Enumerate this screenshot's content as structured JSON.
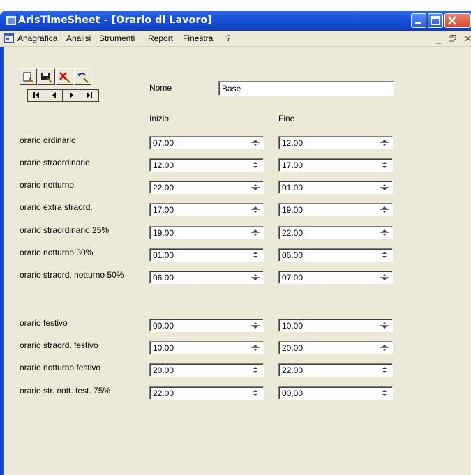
{
  "window": {
    "title": "ArisTimeSheet - [Orario di Lavoro]",
    "menu": [
      "Anagrafica",
      "Analisi",
      "Strumenti",
      "Report",
      "Finestra",
      "?"
    ]
  },
  "toolbar": {
    "buttons": [
      "new-record-icon",
      "save-record-icon",
      "delete-record-icon",
      "undo-icon"
    ],
    "nav": [
      "first",
      "prev",
      "next",
      "last"
    ]
  },
  "form": {
    "nome_label": "Nome",
    "nome_value": "Base",
    "inizio_label": "Inizio",
    "fine_label": "Fine",
    "rows": [
      {
        "label": "orario ordinario",
        "inizio": "07.00",
        "fine": "12.00"
      },
      {
        "label": "orario straordinario",
        "inizio": "12.00",
        "fine": "17.00"
      },
      {
        "label": "orario notturno",
        "inizio": "22.00",
        "fine": "01.00"
      },
      {
        "label": "orario extra straord.",
        "inizio": "17.00",
        "fine": "19.00"
      },
      {
        "label": "orario straordinario 25%",
        "inizio": "19.00",
        "fine": "22.00"
      },
      {
        "label": "orario notturno 30%",
        "inizio": "01.00",
        "fine": "06.00"
      },
      {
        "label": "orario straord. notturno 50%",
        "inizio": "06.00",
        "fine": "07.00"
      },
      {
        "label": "orario festivo",
        "inizio": "00.00",
        "fine": "10.00"
      },
      {
        "label": "orario straord. festivo",
        "inizio": "10.00",
        "fine": "20.00"
      },
      {
        "label": "orario notturno festivo",
        "inizio": "20.00",
        "fine": "22.00"
      },
      {
        "label": "orario str. nott. fest. 75%",
        "inizio": "22.00",
        "fine": "00.00"
      }
    ]
  }
}
